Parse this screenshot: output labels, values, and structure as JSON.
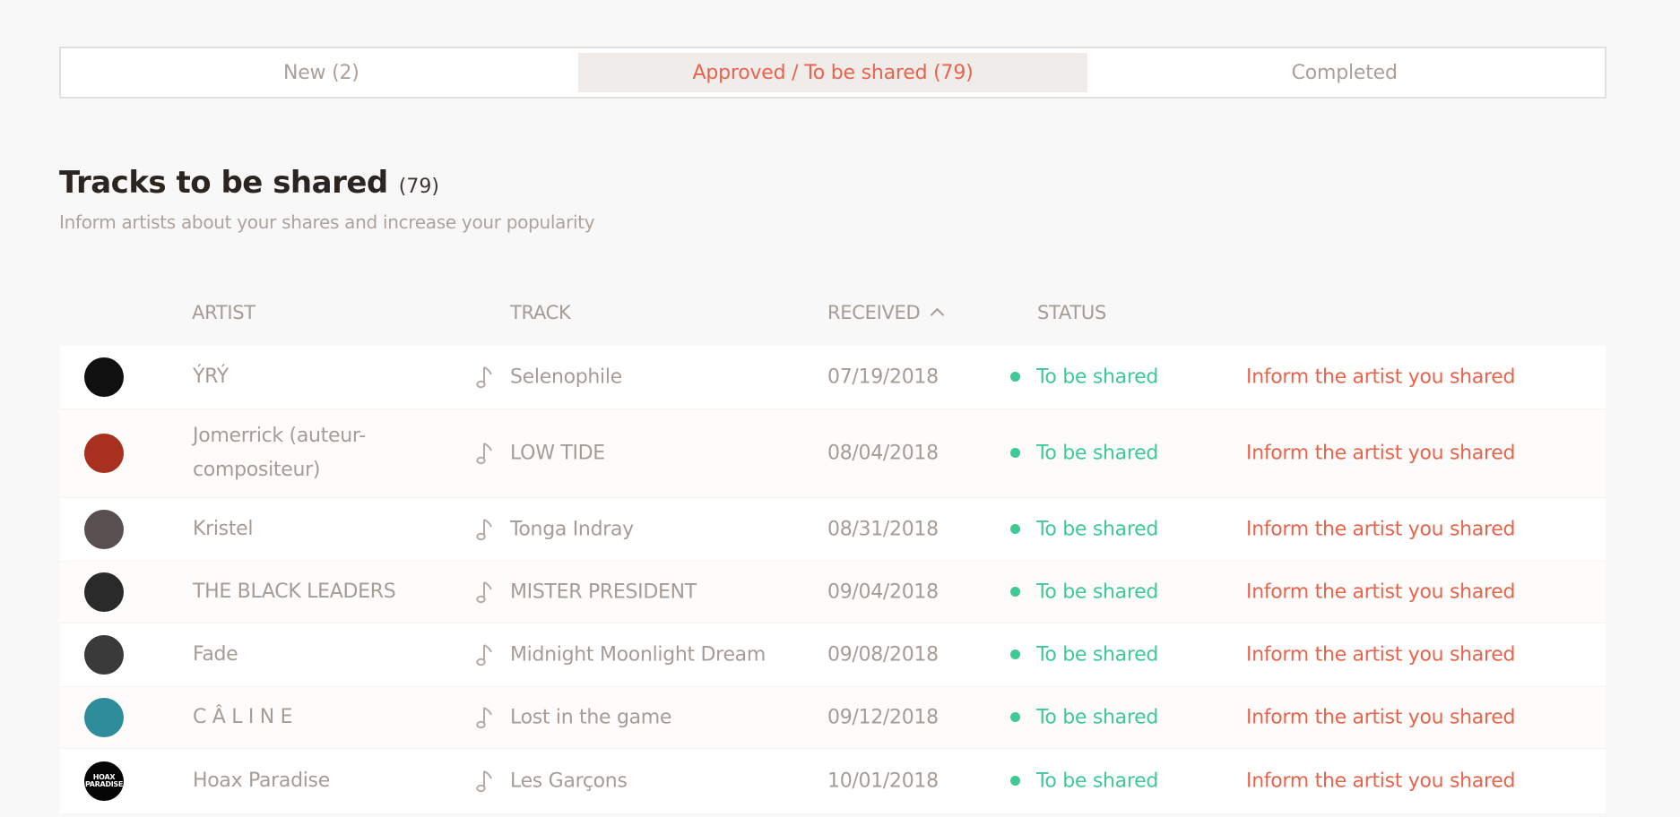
{
  "tabs": [
    {
      "label": "New (2)",
      "active": false
    },
    {
      "label": "Approved / To be shared (79)",
      "active": true
    },
    {
      "label": "Completed",
      "active": false
    }
  ],
  "page": {
    "title": "Tracks to be shared",
    "count": "(79)",
    "subtitle": "Inform artists about your shares and increase your popularity"
  },
  "columns": {
    "artist": "ARTIST",
    "track": "TRACK",
    "received": "RECEIVED",
    "status": "STATUS"
  },
  "colors": {
    "accent": "#e8644c",
    "status_green": "#3ec995",
    "active_tab_bg": "#efece9"
  },
  "rows": [
    {
      "artist": "ÝRÝ",
      "track": "Selenophile",
      "received": "07/19/2018",
      "status": "To be shared",
      "action": "Inform the artist you shared",
      "avatar_color": "#101010",
      "avatar_text": ""
    },
    {
      "artist": "Jomerrick (auteur-compositeur)",
      "track": "LOW TIDE",
      "received": "08/04/2018",
      "status": "To be shared",
      "action": "Inform the artist you shared",
      "avatar_color": "#a8301e",
      "avatar_text": ""
    },
    {
      "artist": "Kristel",
      "track": "Tonga Indray",
      "received": "08/31/2018",
      "status": "To be shared",
      "action": "Inform the artist you shared",
      "avatar_color": "#585050",
      "avatar_text": ""
    },
    {
      "artist": "THE BLACK LEADERS",
      "track": "MISTER PRESIDENT",
      "received": "09/04/2018",
      "status": "To be shared",
      "action": "Inform the artist you shared",
      "avatar_color": "#2a2a2a",
      "avatar_text": ""
    },
    {
      "artist": "Fade",
      "track": "Midnight Moonlight Dream",
      "received": "09/08/2018",
      "status": "To be shared",
      "action": "Inform the artist you shared",
      "avatar_color": "#3a3a3a",
      "avatar_text": ""
    },
    {
      "artist": "C Â L I N E",
      "track": "Lost in the game",
      "received": "09/12/2018",
      "status": "To be shared",
      "action": "Inform the artist you shared",
      "avatar_color": "#2f8c9b",
      "avatar_text": ""
    },
    {
      "artist": "Hoax Paradise",
      "track": "Les Garçons",
      "received": "10/01/2018",
      "status": "To be shared",
      "action": "Inform the artist you shared",
      "avatar_color": "#050505",
      "avatar_text": "HOAX PARADISE"
    }
  ]
}
